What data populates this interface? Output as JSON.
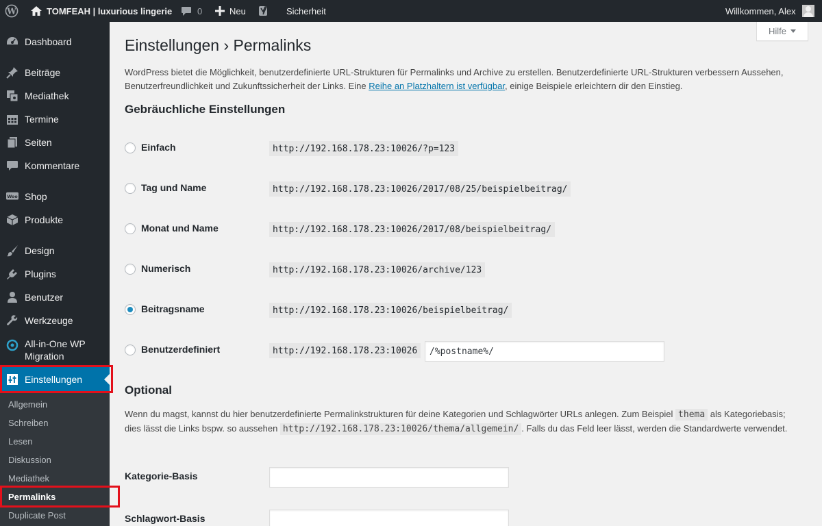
{
  "admin_bar": {
    "site_name": "TOMFEAH | luxurious lingerie",
    "comment_count": "0",
    "new_label": "Neu",
    "security_label": "Sicherheit",
    "greeting": "Willkommen, Alex",
    "icons": [
      "wordpress-logo-icon",
      "home-icon",
      "comment-icon",
      "plus-icon",
      "yoast-icon",
      "avatar"
    ]
  },
  "sidebar": {
    "items": [
      {
        "label": "Dashboard",
        "icon": "dashboard-icon"
      },
      {
        "label": "Beiträge",
        "icon": "pin-icon"
      },
      {
        "label": "Mediathek",
        "icon": "media-icon"
      },
      {
        "label": "Termine",
        "icon": "calendar-icon"
      },
      {
        "label": "Seiten",
        "icon": "page-icon"
      },
      {
        "label": "Kommentare",
        "icon": "comment-icon"
      },
      {
        "label": "Shop",
        "icon": "woo-icon"
      },
      {
        "label": "Produkte",
        "icon": "box-icon"
      },
      {
        "label": "Design",
        "icon": "brush-icon"
      },
      {
        "label": "Plugins",
        "icon": "plugin-icon"
      },
      {
        "label": "Benutzer",
        "icon": "user-icon"
      },
      {
        "label": "Werkzeuge",
        "icon": "wrench-icon"
      },
      {
        "label": "All-in-One WP Migration",
        "icon": "migration-icon"
      },
      {
        "label": "Einstellungen",
        "icon": "settings-icon",
        "current": true
      }
    ],
    "submenu": [
      "Allgemein",
      "Schreiben",
      "Lesen",
      "Diskussion",
      "Mediathek",
      "Permalinks",
      "Duplicate Post"
    ],
    "submenu_current": "Permalinks",
    "highlight_color": "#e3101b",
    "current_color": "#0073aa"
  },
  "help_tab": {
    "label": "Hilfe"
  },
  "page": {
    "title": "Einstellungen › Permalinks",
    "intro_before": "WordPress bietet die Möglichkeit, benutzerdefinierte URL-Strukturen für Permalinks und Archive zu erstellen. Benutzerdefinierte URL-Strukturen verbessern Aussehen, Benutzerfreundlichkeit und Zukunftssicherheit der Links. Eine ",
    "intro_link": "Reihe an Platzhaltern ist verfügbar",
    "intro_after": ", einige Beispiele erleichtern dir den Einstieg.",
    "common_heading": "Gebräuchliche Einstellungen",
    "options": [
      {
        "label": "Einfach",
        "example": "http://192.168.178.23:10026/?p=123",
        "checked": false
      },
      {
        "label": "Tag und Name",
        "example": "http://192.168.178.23:10026/2017/08/25/beispielbeitrag/",
        "checked": false
      },
      {
        "label": "Monat und Name",
        "example": "http://192.168.178.23:10026/2017/08/beispielbeitrag/",
        "checked": false
      },
      {
        "label": "Numerisch",
        "example": "http://192.168.178.23:10026/archive/123",
        "checked": false
      },
      {
        "label": "Beitragsname",
        "example": "http://192.168.178.23:10026/beispielbeitrag/",
        "checked": true
      },
      {
        "label": "Benutzerdefiniert",
        "example": "http://192.168.178.23:10026",
        "checked": false,
        "value": "/%postname%/"
      }
    ],
    "optional_heading": "Optional",
    "optional_text": {
      "part1": "Wenn du magst, kannst du hier benutzerdefinierte Permalinkstrukturen für deine Kategorien und Schlagwörter URLs anlegen. Zum Beispiel ",
      "code1": "thema",
      "part2": " als Kategoriebasis; dies lässt die Links bspw. so aussehen ",
      "code2": "http://192.168.178.23:10026/thema/allgemein/",
      "part3": ". Falls du das Feld leer lässt, werden die Standardwerte verwendet."
    },
    "category_base_label": "Kategorie-Basis",
    "category_base_value": "",
    "tag_base_label": "Schlagwort-Basis",
    "tag_base_value": ""
  }
}
